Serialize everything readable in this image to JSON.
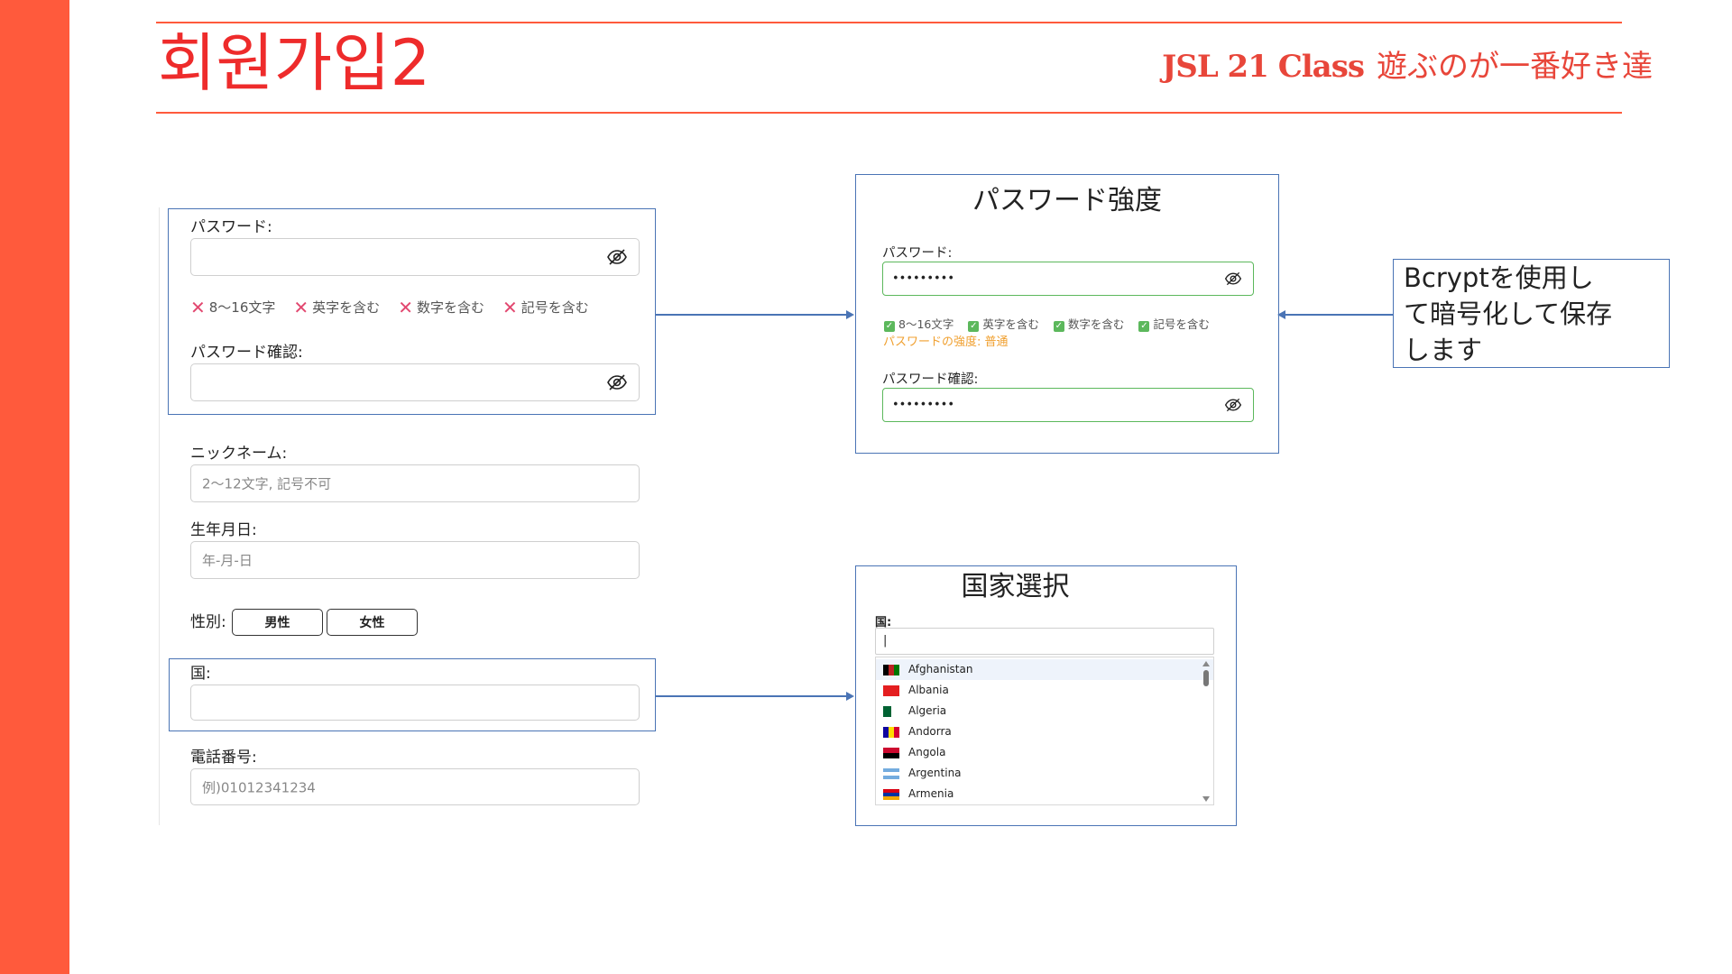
{
  "colors": {
    "accent": "#ff5a3c",
    "title_red": "#ee2b2b",
    "brand_red": "#e8463a",
    "frame_blue": "#4a74b5",
    "valid_green": "#5cb85c",
    "invalid_pink": "#e24870",
    "strength_orange": "#f0a030"
  },
  "header": {
    "title": "회원가입2",
    "brand_strong": "JSL 21 Class",
    "brand_tagline": "遊ぶのが一番好き達"
  },
  "form": {
    "password_label": "パスワード:",
    "password_rules": [
      {
        "icon": "x-mark-icon",
        "text": "8〜16文字"
      },
      {
        "icon": "x-mark-icon",
        "text": "英字を含む"
      },
      {
        "icon": "x-mark-icon",
        "text": "数字を含む"
      },
      {
        "icon": "x-mark-icon",
        "text": "記号を含む"
      }
    ],
    "password_confirm_label": "パスワード確認:",
    "nickname_label": "ニックネーム:",
    "nickname_placeholder": "2〜12文字, 記号不可",
    "birthday_label": "生年月日:",
    "birthday_placeholder": "年-月-日",
    "gender_label": "性別:",
    "gender_options": [
      "男性",
      "女性"
    ],
    "country_label": "国:",
    "phone_label": "電話番号:",
    "phone_placeholder": "例)01012341234"
  },
  "strength_panel": {
    "title": "パスワード強度",
    "password_label": "パスワード:",
    "password_mask": "•••••••••",
    "rules": [
      "8〜16文字",
      "英字を含む",
      "数字を含む",
      "記号を含む"
    ],
    "strength_text": "パスワードの強度: 普通",
    "confirm_label": "パスワード確認:",
    "confirm_mask": "•••••••••"
  },
  "note_box": {
    "text_line1": "Bcryptを使用し",
    "text_line2": "て暗号化して保存",
    "text_line3": "します"
  },
  "country_panel": {
    "title": "国家選択",
    "label": "国:",
    "input_value": "|",
    "countries": [
      {
        "name": "Afghanistan",
        "flag": "af"
      },
      {
        "name": "Albania",
        "flag": "al"
      },
      {
        "name": "Algeria",
        "flag": "dz"
      },
      {
        "name": "Andorra",
        "flag": "ad"
      },
      {
        "name": "Angola",
        "flag": "ao"
      },
      {
        "name": "Argentina",
        "flag": "ar"
      },
      {
        "name": "Armenia",
        "flag": "am"
      }
    ]
  }
}
